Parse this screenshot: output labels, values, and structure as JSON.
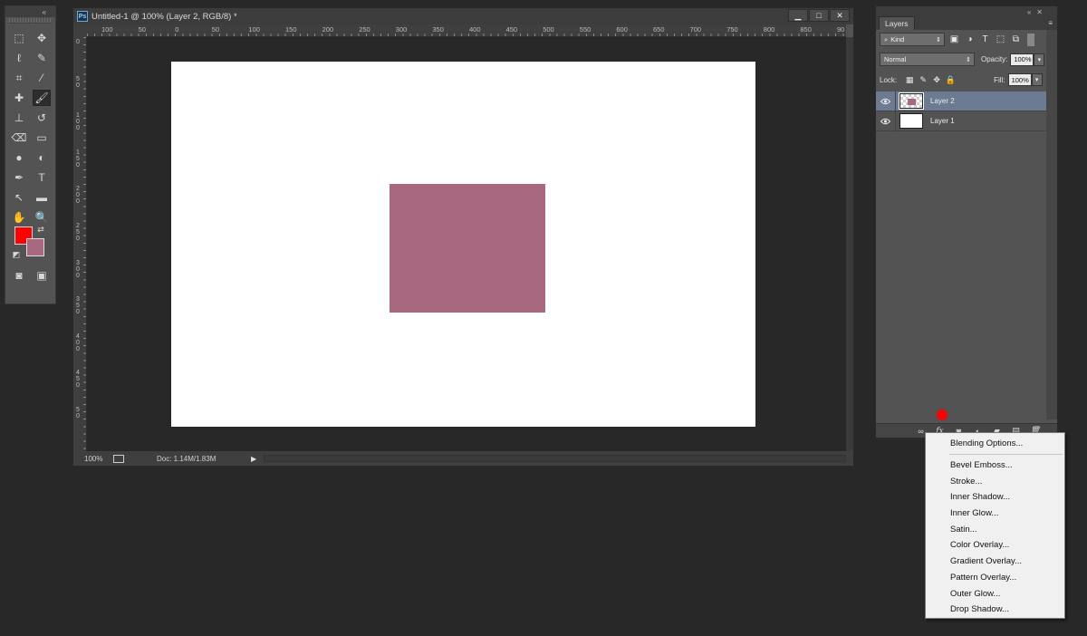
{
  "toolbox": {
    "collapse_glyph": "«",
    "tools": [
      {
        "name": "rectangular-marquee-icon",
        "glyph": "⬚"
      },
      {
        "name": "move-tool-icon",
        "glyph": "✥"
      },
      {
        "name": "lasso-icon",
        "glyph": "ℓ"
      },
      {
        "name": "quick-selection-icon",
        "glyph": "✎"
      },
      {
        "name": "crop-icon",
        "glyph": "⌗"
      },
      {
        "name": "eyedropper-icon",
        "glyph": "⁄"
      },
      {
        "name": "healing-brush-icon",
        "glyph": "✚"
      },
      {
        "name": "brush-icon",
        "glyph": "🖌"
      },
      {
        "name": "clone-stamp-icon",
        "glyph": "⊥"
      },
      {
        "name": "history-brush-icon",
        "glyph": "↺"
      },
      {
        "name": "eraser-icon",
        "glyph": "⌫"
      },
      {
        "name": "gradient-icon",
        "glyph": "▭"
      },
      {
        "name": "blur-icon",
        "glyph": "●"
      },
      {
        "name": "dodge-icon",
        "glyph": "◐"
      },
      {
        "name": "pen-icon",
        "glyph": "✒"
      },
      {
        "name": "type-icon",
        "glyph": "T"
      },
      {
        "name": "path-selection-icon",
        "glyph": "↖"
      },
      {
        "name": "rectangle-shape-icon",
        "glyph": "▬"
      },
      {
        "name": "hand-icon",
        "glyph": "✋"
      },
      {
        "name": "zoom-icon",
        "glyph": "🔍"
      },
      {
        "name": "quick-mask-icon",
        "glyph": "◙"
      },
      {
        "name": "screen-mode-icon",
        "glyph": "▣"
      }
    ],
    "foreground_color": "#ff0000",
    "background_color": "#a8687f"
  },
  "document": {
    "title": "Untitled-1 @ 100% (Layer 2, RGB/8) *",
    "app_badge": "Ps",
    "window_buttons": {
      "minimize": "▁",
      "maximize": "□",
      "close": "✕"
    },
    "ruler_top_ticks": [
      "100",
      "50",
      "0",
      "50",
      "100",
      "150",
      "200",
      "250",
      "300",
      "350",
      "400",
      "450",
      "500",
      "550",
      "600",
      "650",
      "700",
      "750",
      "800",
      "850",
      "90"
    ],
    "ruler_left_ticks": [
      "0",
      "5 0",
      "1 0 0",
      "1 5 0",
      "2 0 0",
      "2 5 0",
      "3 0 0",
      "3 5 0",
      "4 0 0",
      "4 5 0",
      "5 0"
    ],
    "canvas_color": "#ffffff",
    "shape_color": "#a8687f",
    "status": {
      "zoom": "100%",
      "doc_size": "Doc: 1.14M/1.83M",
      "arrow": "▶"
    }
  },
  "layers_panel": {
    "collapse_glyph": "«",
    "close_glyph": "✕",
    "tab_label": "Layers",
    "menu_glyph": "≡",
    "filter_kind": "Kind",
    "blend_mode": "Normal",
    "opacity_label": "Opacity:",
    "opacity_value": "100%",
    "lock_label": "Lock:",
    "fill_label": "Fill:",
    "fill_value": "100%",
    "layers": [
      {
        "name": "Layer 2",
        "selected": true
      },
      {
        "name": "Layer 1",
        "selected": false
      }
    ],
    "footer_icons": [
      "link-layers-icon",
      "fx-icon",
      "layer-mask-icon",
      "adjustment-layer-icon",
      "group-folder-icon",
      "new-layer-icon",
      "trash-icon"
    ],
    "footer_glyphs": [
      "∞",
      "fx",
      "◙",
      "◐",
      "▰",
      "▤",
      "🗑"
    ]
  },
  "fx_menu": {
    "items": [
      "Blending Options...",
      "Bevel  Emboss...",
      "Stroke...",
      "Inner Shadow...",
      "Inner Glow...",
      "Satin...",
      "Color Overlay...",
      "Gradient Overlay...",
      "Pattern Overlay...",
      "Outer Glow...",
      "Drop Shadow..."
    ]
  }
}
